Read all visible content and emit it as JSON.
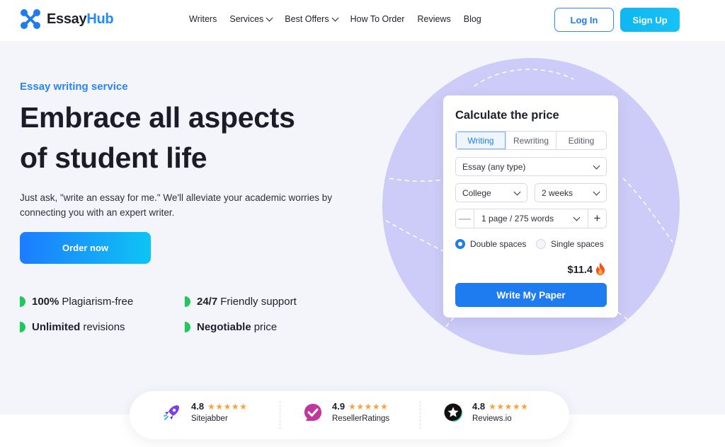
{
  "header": {
    "logo": {
      "name_part1": "Essay",
      "name_part2": "Hub"
    },
    "nav": [
      {
        "label": "Writers",
        "has_dropdown": false
      },
      {
        "label": "Services",
        "has_dropdown": true
      },
      {
        "label": "Best Offers",
        "has_dropdown": true
      },
      {
        "label": "How To Order",
        "has_dropdown": false
      },
      {
        "label": "Reviews",
        "has_dropdown": false
      },
      {
        "label": "Blog",
        "has_dropdown": false
      }
    ],
    "login_label": "Log In",
    "signup_label": "Sign Up"
  },
  "hero": {
    "eyebrow": "Essay writing service",
    "headline_line1": "Embrace all aspects",
    "headline_line2": "of student life",
    "lead": "Just ask, \"write an essay for me.\" We'll alleviate your academic worries by connecting you with an expert writer.",
    "order_button": "Order now",
    "features": [
      {
        "bold": "100%",
        "text": "Plagiarism-free"
      },
      {
        "bold": "24/7",
        "text": "Friendly support"
      },
      {
        "bold": "Unlimited",
        "text": "revisions"
      },
      {
        "bold": "Negotiable",
        "text": "price"
      }
    ]
  },
  "calculator": {
    "title": "Calculate the price",
    "tabs": [
      {
        "label": "Writing",
        "active": true
      },
      {
        "label": "Rewriting",
        "active": false
      },
      {
        "label": "Editing",
        "active": false
      }
    ],
    "paper_type": "Essay (any type)",
    "academic_level": "College",
    "deadline": "2 weeks",
    "pages": "1 page / 275 words",
    "minus_label": "—",
    "plus_label": "+",
    "spacing_options": [
      {
        "label": "Double spaces",
        "checked": true
      },
      {
        "label": "Single spaces",
        "checked": false
      }
    ],
    "price": "$11.4",
    "price_icon": "fire-icon",
    "submit_label": "Write My Paper"
  },
  "ratings": [
    {
      "score": "4.8",
      "stars": "★★★★★",
      "source": "Sitejabber",
      "icon": "rocket-icon"
    },
    {
      "score": "4.9",
      "stars": "★★★★★",
      "source": "ResellerRatings",
      "icon": "check-bubble-icon"
    },
    {
      "score": "4.8",
      "stars": "★★★★★",
      "source": "Reviews.io",
      "icon": "star-badge-icon"
    }
  ],
  "colors": {
    "accent": "#1f7cf0",
    "cyan": "#0fb6f2",
    "hero_bg": "#f4f4fb",
    "circle": "#cdcbf7",
    "feature_dot": "#23c55e",
    "star": "#f7a23a"
  }
}
